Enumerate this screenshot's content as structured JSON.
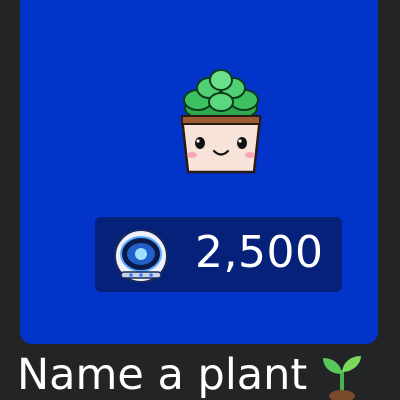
{
  "card": {
    "background_color": "#0334c9",
    "image_icon": "succulent-pot-icon"
  },
  "price": {
    "icon": "astronaut-helmet-icon",
    "value": "2,500"
  },
  "caption": {
    "text": "Name a plant",
    "icon": "seedling-icon"
  }
}
